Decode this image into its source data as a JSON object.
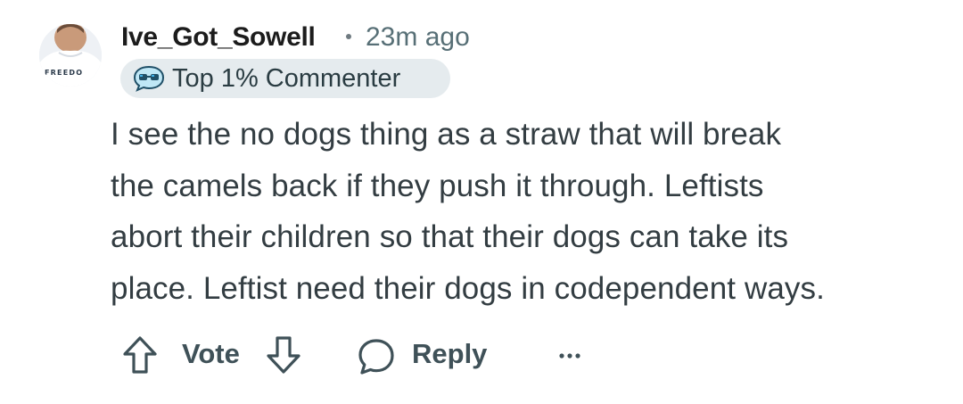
{
  "comment": {
    "username": "Ive_Got_Sowell",
    "timestamp": "23m ago",
    "flair": {
      "label": "Top 1% Commenter",
      "icon": "sunglasses-speech-bubble-icon"
    },
    "avatar": {
      "icon": "user-avatar",
      "shirt_text": "FREEDO"
    },
    "body": [
      "I see the no dogs thing as a straw that will break",
      "the camels back if they push it through. Leftists",
      "abort their children so that their dogs can take its",
      "place. Leftist need their dogs in codependent ways."
    ]
  },
  "actions": {
    "upvote_icon": "arrow-up-outline-icon",
    "vote_label": "Vote",
    "downvote_icon": "arrow-down-outline-icon",
    "reply_icon": "speech-bubble-icon",
    "reply_label": "Reply",
    "more_icon": "ellipsis-icon"
  },
  "colors": {
    "username": "#1c1c1c",
    "meta": "#576f76",
    "body_text": "#333d42",
    "action_text": "#3f5158",
    "flair_bg": "#e5ebee",
    "flair_icon_accent": "#3fb0e8"
  }
}
